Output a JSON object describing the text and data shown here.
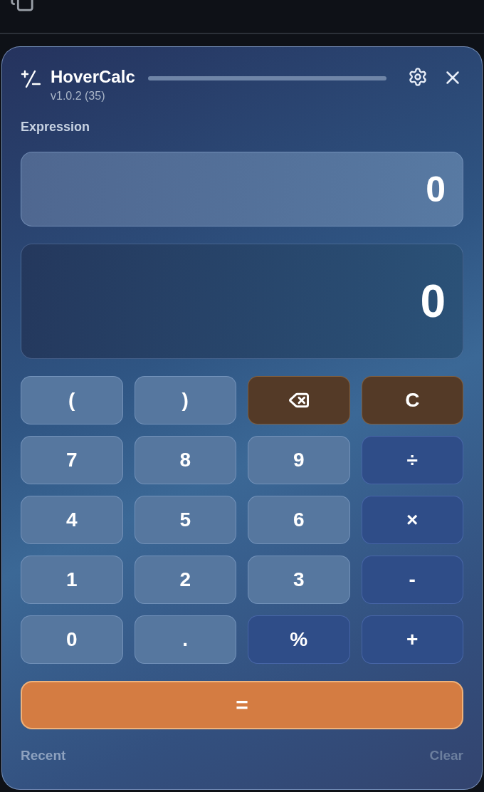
{
  "app": {
    "title": "HoverCalc",
    "version": "v1.0.2 (35)"
  },
  "expression": {
    "label": "Expression",
    "value": "0"
  },
  "result": {
    "value": "0"
  },
  "keys": [
    {
      "kind": "digit",
      "label": "("
    },
    {
      "kind": "digit",
      "label": ")"
    },
    {
      "kind": "backspace"
    },
    {
      "kind": "danger",
      "label": "C"
    },
    {
      "kind": "digit",
      "label": "7"
    },
    {
      "kind": "digit",
      "label": "8"
    },
    {
      "kind": "digit",
      "label": "9"
    },
    {
      "kind": "operator",
      "label": "÷"
    },
    {
      "kind": "digit",
      "label": "4"
    },
    {
      "kind": "digit",
      "label": "5"
    },
    {
      "kind": "digit",
      "label": "6"
    },
    {
      "kind": "operator",
      "label": "×"
    },
    {
      "kind": "digit",
      "label": "1"
    },
    {
      "kind": "digit",
      "label": "2"
    },
    {
      "kind": "digit",
      "label": "3"
    },
    {
      "kind": "operator",
      "label": "-"
    },
    {
      "kind": "digit",
      "label": "0"
    },
    {
      "kind": "digit",
      "label": "."
    },
    {
      "kind": "operator",
      "label": "%"
    },
    {
      "kind": "operator",
      "label": "+"
    }
  ],
  "equals": {
    "label": "="
  },
  "history": {
    "title": "Recent",
    "clear": {
      "label": "Clear",
      "disabled": true
    }
  }
}
